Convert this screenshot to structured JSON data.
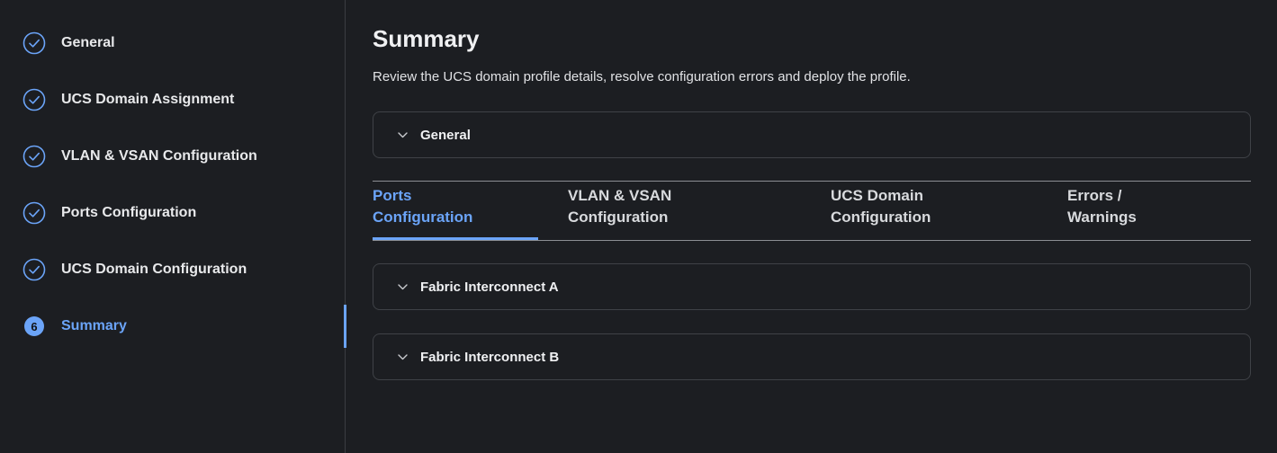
{
  "sidebar": {
    "steps": [
      {
        "label": "General",
        "state": "complete"
      },
      {
        "label": "UCS Domain Assignment",
        "state": "complete"
      },
      {
        "label": "VLAN & VSAN Configuration",
        "state": "complete"
      },
      {
        "label": "Ports Configuration",
        "state": "complete"
      },
      {
        "label": "UCS Domain Configuration",
        "state": "complete"
      },
      {
        "label": "Summary",
        "state": "active",
        "number": "6"
      }
    ]
  },
  "main": {
    "title": "Summary",
    "description": "Review the UCS domain profile details, resolve configuration errors and deploy the profile.",
    "general_section": {
      "label": "General"
    },
    "tabs": [
      {
        "line1": "Ports",
        "line2": "Configuration",
        "active": true
      },
      {
        "line1": "VLAN & VSAN",
        "line2": "Configuration",
        "active": false
      },
      {
        "line1": "UCS Domain",
        "line2": "Configuration",
        "active": false
      },
      {
        "line1": "Errors /",
        "line2": "Warnings",
        "active": false
      }
    ],
    "sections": [
      {
        "label": "Fabric Interconnect A"
      },
      {
        "label": "Fabric Interconnect B"
      }
    ]
  },
  "colors": {
    "background": "#1c1e22",
    "accent": "#6ba4f8",
    "border": "#3f4247",
    "text": "#e8e9eb"
  },
  "icons": {
    "complete": "check-circle-icon",
    "collapse": "chevron-down-icon"
  }
}
